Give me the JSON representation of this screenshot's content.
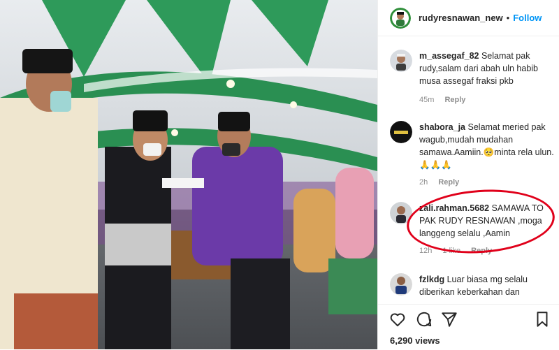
{
  "post": {
    "username": "rudyresnawan_new",
    "separator": "•",
    "follow_label": "Follow"
  },
  "comments": [
    {
      "username": "m_assegaf_82",
      "text": "Selamat pak rudy,salam dari abah uln habib musa assegaf fraksi pkb",
      "age": "45m",
      "likes": "",
      "reply_label": "Reply"
    },
    {
      "username": "shabora_ja",
      "text": "Selamat meried pak wagub,mudah mudahan samawa.Aamiin.🥺minta rela ulun.🙏🙏🙏",
      "age": "2h",
      "likes": "",
      "reply_label": "Reply"
    },
    {
      "username": "zali.rahman.5682",
      "text": "SAMAWA TO PAK RUDY RESNAWAN ,moga langgeng selalu ,Aamin",
      "age": "12h",
      "likes": "1 like",
      "reply_label": "Reply"
    },
    {
      "username": "fzlkdg",
      "text": "Luar biasa mg selalu diberikan keberkahan dan",
      "age": "",
      "likes": "",
      "reply_label": ""
    }
  ],
  "actions": {
    "views": "6,290 views",
    "icons": [
      "heart-icon",
      "comment-icon",
      "share-icon",
      "bookmark-icon"
    ]
  },
  "colors": {
    "link": "#0095f6",
    "text": "#262626",
    "muted": "#8e8e8e",
    "highlight_circle": "#e0001a"
  }
}
